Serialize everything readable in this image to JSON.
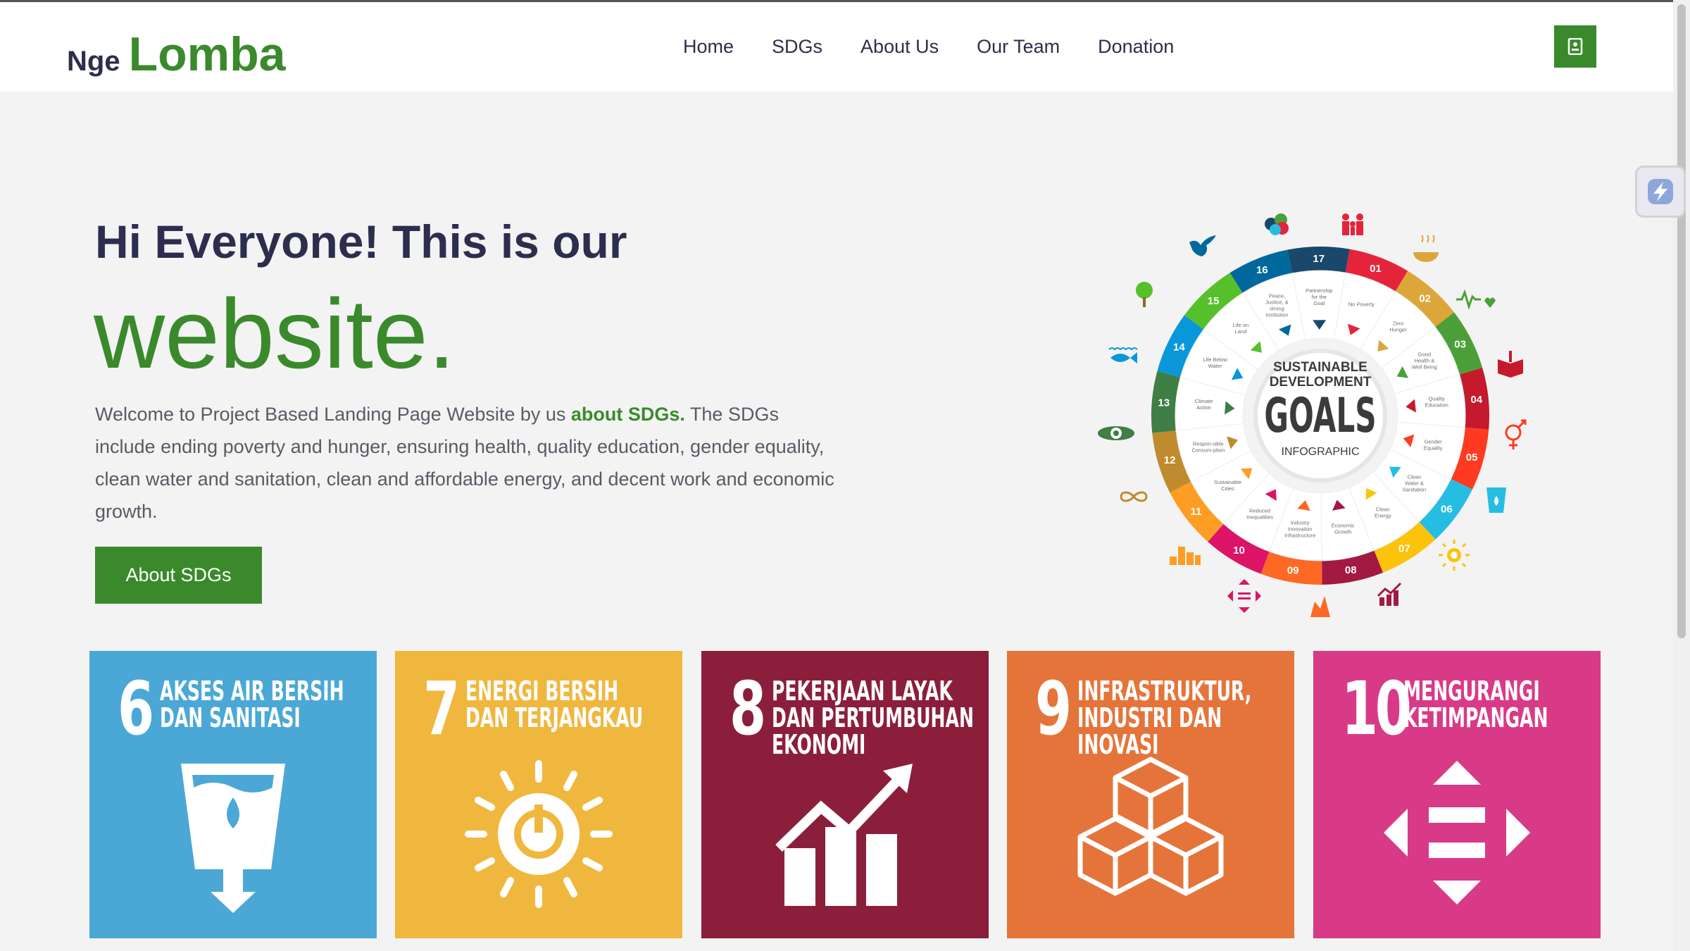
{
  "header": {
    "logo_prefix": "Nge",
    "logo_main": "Lomba",
    "nav": [
      "Home",
      "SDGs",
      "About Us",
      "Our Team",
      "Donation"
    ]
  },
  "hero": {
    "line1": "Hi Everyone! This is our",
    "line2": "website",
    "line2_dot": ".",
    "desc_before": "Welcome to Project Based Landing Page Website by us ",
    "desc_highlight": "about SDGs.",
    "desc_after": " The SDGs include ending poverty and hunger, ensuring health, quality education, gender equality, clean water and sanitation, clean and affordable energy, and decent work and economic growth.",
    "cta_label": "About SDGs"
  },
  "infographic": {
    "line1": "SUSTAINABLE",
    "line2": "DEVELOPMENT",
    "line3": "GOALS",
    "line4": "INFOGRAPHIC",
    "segments": [
      {
        "n": "01",
        "label": "No Poverty",
        "color": "#e5243b"
      },
      {
        "n": "02",
        "label": "Zero Hunger",
        "color": "#dda63a"
      },
      {
        "n": "03",
        "label": "Good Health & Well Being",
        "color": "#4c9f38"
      },
      {
        "n": "04",
        "label": "Quality Education",
        "color": "#c5192d"
      },
      {
        "n": "05",
        "label": "Gender Equality",
        "color": "#ff3a21"
      },
      {
        "n": "06",
        "label": "Clean Water & Sanitation",
        "color": "#26bde2"
      },
      {
        "n": "07",
        "label": "Clean Energy",
        "color": "#fcc30b"
      },
      {
        "n": "08",
        "label": "Economic Growth",
        "color": "#a21942"
      },
      {
        "n": "09",
        "label": "Industry Innovation Infrastructure",
        "color": "#fd6925"
      },
      {
        "n": "10",
        "label": "Reduced Inequalities",
        "color": "#dd1367"
      },
      {
        "n": "11",
        "label": "Sustainable Cities",
        "color": "#fd9d24"
      },
      {
        "n": "12",
        "label": "Respon-sible Consum-ption",
        "color": "#bf8b2e"
      },
      {
        "n": "13",
        "label": "Climate Action",
        "color": "#3f7e44"
      },
      {
        "n": "14",
        "label": "Life Below Water",
        "color": "#0a97d9"
      },
      {
        "n": "15",
        "label": "Life on Land",
        "color": "#56c02b"
      },
      {
        "n": "16",
        "label": "Peace, Justice, & strong Institution",
        "color": "#00689d"
      },
      {
        "n": "17",
        "label": "Partnership for the Goal",
        "color": "#19486a"
      }
    ]
  },
  "tiles": [
    {
      "num": "6",
      "title": "AKSES AIR BERSIH\nDAN SANITASI",
      "color": "#4ba8d6",
      "icon": "water-glass-icon"
    },
    {
      "num": "7",
      "title": "ENERGI BERSIH\nDAN TERJANGKAU",
      "color": "#f0b73e",
      "icon": "sun-power-icon"
    },
    {
      "num": "8",
      "title": "PEKERJAAN LAYAK\nDAN PERTUMBUHAN\nEKONOMI",
      "color": "#8b1f3b",
      "icon": "growth-chart-icon"
    },
    {
      "num": "9",
      "title": "INFRASTRUKTUR,\nINDUSTRI DAN\nINOVASI",
      "color": "#e5743a",
      "icon": "cubes-icon"
    },
    {
      "num": "10",
      "title": "MENGURANGI\nKETIMPANGAN",
      "color": "#d93a87",
      "icon": "arrows-equal-icon"
    }
  ]
}
